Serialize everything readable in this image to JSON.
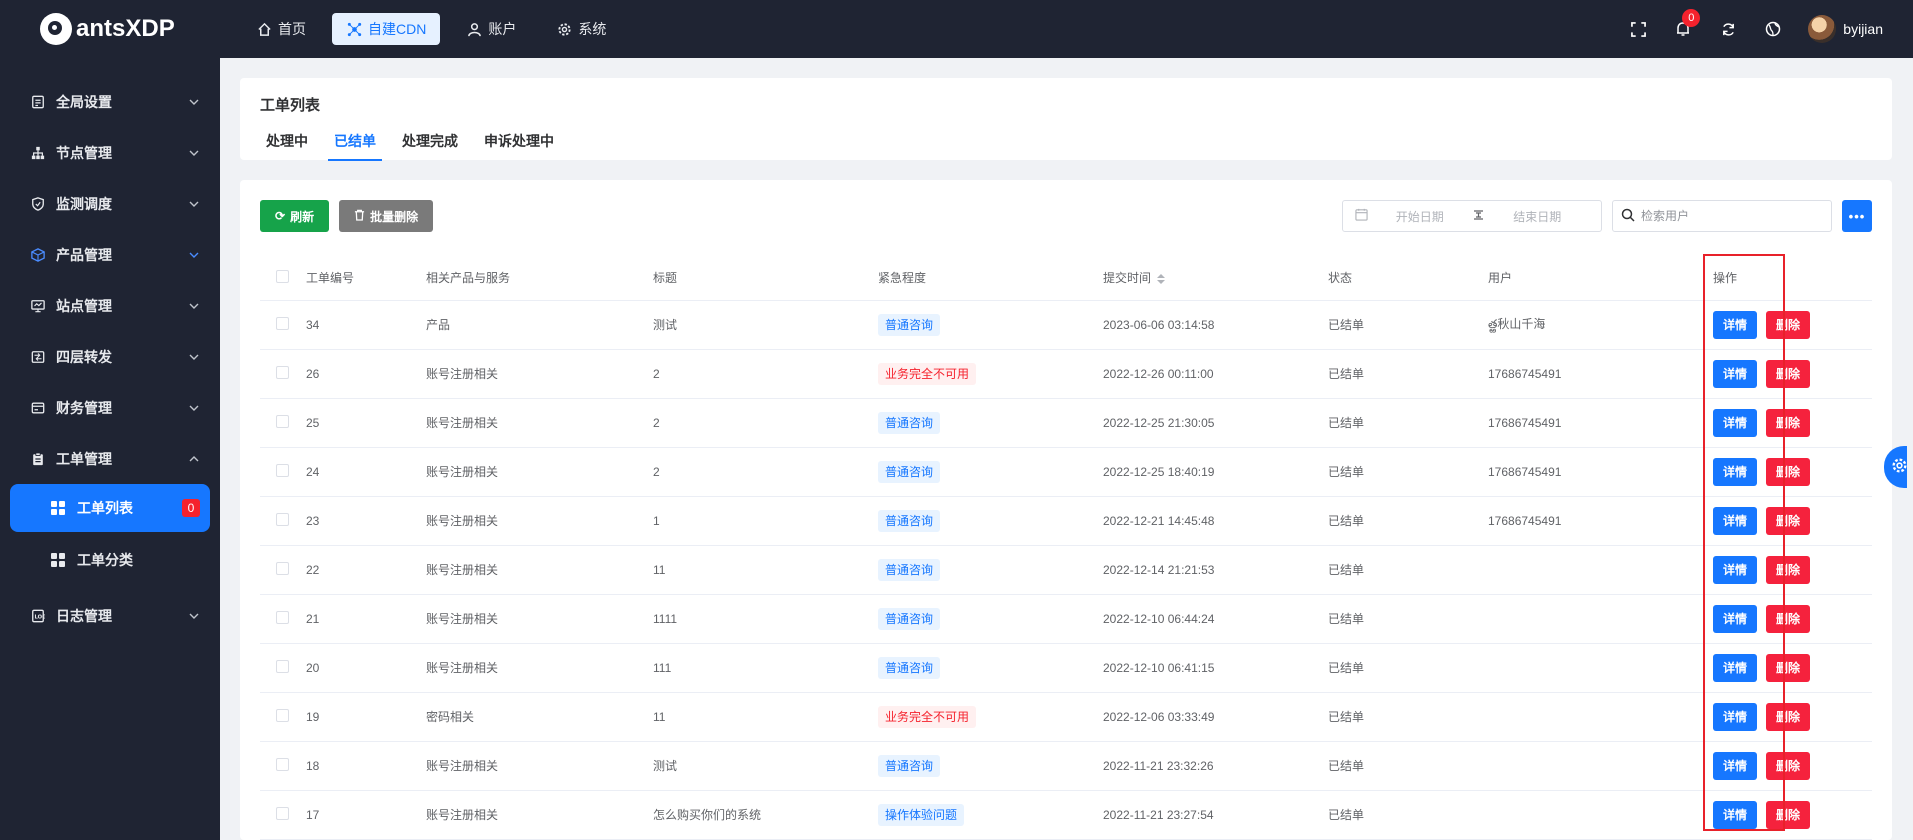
{
  "brand": {
    "name": "antsXDP"
  },
  "topnav": [
    {
      "label": "首页",
      "icon": "home-icon",
      "active": false
    },
    {
      "label": "自建CDN",
      "icon": "cdn-icon",
      "active": true
    },
    {
      "label": "账户",
      "icon": "user-icon",
      "active": false
    },
    {
      "label": "系统",
      "icon": "gear-icon",
      "active": false
    }
  ],
  "header_right": {
    "notifications": "0",
    "username": "byijian"
  },
  "sidebar": {
    "menus": [
      {
        "label": "全局设置",
        "icon": "settings-doc-icon",
        "expanded": false
      },
      {
        "label": "节点管理",
        "icon": "node-tree-icon",
        "expanded": false
      },
      {
        "label": "监测调度",
        "icon": "shield-icon",
        "expanded": false
      },
      {
        "label": "产品管理",
        "icon": "cube-icon",
        "expanded": false
      },
      {
        "label": "站点管理",
        "icon": "monitor-icon",
        "expanded": false
      },
      {
        "label": "四层转发",
        "icon": "forward-icon",
        "expanded": false
      },
      {
        "label": "财务管理",
        "icon": "wallet-icon",
        "expanded": false
      },
      {
        "label": "工单管理",
        "icon": "clipboard-icon",
        "expanded": true
      }
    ],
    "submenus": [
      {
        "label": "工单列表",
        "count": "0",
        "active": true
      },
      {
        "label": "工单分类",
        "active": false
      }
    ],
    "last_menu": {
      "label": "日志管理",
      "icon": "log-icon",
      "expanded": false
    }
  },
  "page": {
    "title": "工单列表",
    "tabs": [
      "处理中",
      "已结单",
      "处理完成",
      "申诉处理中"
    ],
    "active_tab": "已结单"
  },
  "toolbar": {
    "refresh_label": "刷新",
    "bulk_delete_label": "批量删除",
    "start_date_placeholder": "开始日期",
    "end_date_placeholder": "结束日期",
    "search_placeholder": "检索用户",
    "more_label": "•••"
  },
  "table": {
    "columns": [
      "工单编号",
      "相关产品与服务",
      "标题",
      "紧急程度",
      "提交时间",
      "状态",
      "用户",
      "操作"
    ],
    "detail_label": "详情",
    "delete_label": "删除",
    "rows": [
      {
        "id": "34",
        "product": "产品",
        "title": "测试",
        "urgency": "普通咨询",
        "urgency_type": "blue",
        "time": "2023-06-06 03:14:58",
        "status": "已结单",
        "user": "త్ఱ秋山千海"
      },
      {
        "id": "26",
        "product": "账号注册相关",
        "title": "2",
        "urgency": "业务完全不可用",
        "urgency_type": "red",
        "time": "2022-12-26 00:11:00",
        "status": "已结单",
        "user": "17686745491"
      },
      {
        "id": "25",
        "product": "账号注册相关",
        "title": "2",
        "urgency": "普通咨询",
        "urgency_type": "blue",
        "time": "2022-12-25 21:30:05",
        "status": "已结单",
        "user": "17686745491"
      },
      {
        "id": "24",
        "product": "账号注册相关",
        "title": "2",
        "urgency": "普通咨询",
        "urgency_type": "blue",
        "time": "2022-12-25 18:40:19",
        "status": "已结单",
        "user": "17686745491"
      },
      {
        "id": "23",
        "product": "账号注册相关",
        "title": "1",
        "urgency": "普通咨询",
        "urgency_type": "blue",
        "time": "2022-12-21 14:45:48",
        "status": "已结单",
        "user": "17686745491"
      },
      {
        "id": "22",
        "product": "账号注册相关",
        "title": "11",
        "urgency": "普通咨询",
        "urgency_type": "blue",
        "time": "2022-12-14 21:21:53",
        "status": "已结单",
        "user": ""
      },
      {
        "id": "21",
        "product": "账号注册相关",
        "title": "1111",
        "urgency": "普通咨询",
        "urgency_type": "blue",
        "time": "2022-12-10 06:44:24",
        "status": "已结单",
        "user": ""
      },
      {
        "id": "20",
        "product": "账号注册相关",
        "title": "111",
        "urgency": "普通咨询",
        "urgency_type": "blue",
        "time": "2022-12-10 06:41:15",
        "status": "已结单",
        "user": ""
      },
      {
        "id": "19",
        "product": "密码相关",
        "title": "11",
        "urgency": "业务完全不可用",
        "urgency_type": "red",
        "time": "2022-12-06 03:33:49",
        "status": "已结单",
        "user": ""
      },
      {
        "id": "18",
        "product": "账号注册相关",
        "title": "测试",
        "urgency": "普通咨询",
        "urgency_type": "blue",
        "time": "2022-11-21 23:32:26",
        "status": "已结单",
        "user": ""
      },
      {
        "id": "17",
        "product": "账号注册相关",
        "title": "怎么购买你们的系统",
        "urgency": "操作体验问题",
        "urgency_type": "blue",
        "time": "2022-11-21 23:27:54",
        "status": "已结单",
        "user": ""
      }
    ]
  },
  "colors": {
    "primary": "#1677ff",
    "danger": "#f5223d",
    "success": "#16a34a",
    "sidebar_bg": "#1f2433",
    "highlight_box": "#e8212a"
  }
}
